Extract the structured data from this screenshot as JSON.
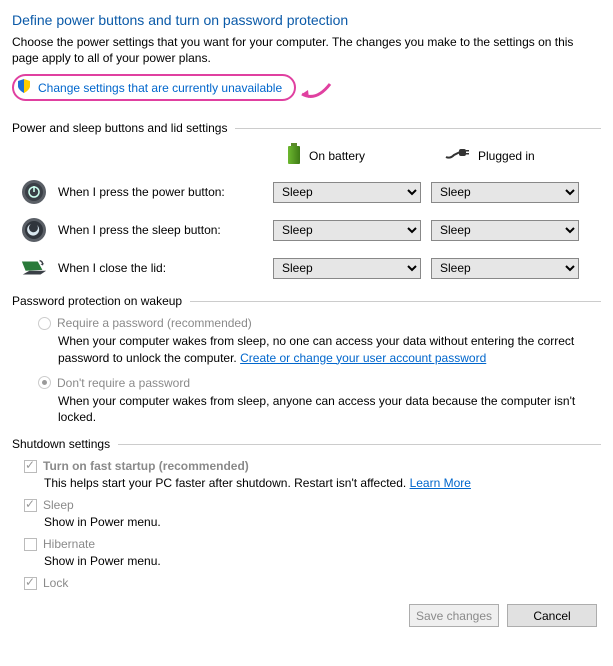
{
  "title": "Define power buttons and turn on password protection",
  "desc": "Choose the power settings that you want for your computer. The changes you make to the settings on this page apply to all of your power plans.",
  "change_link": "Change settings that are currently unavailable",
  "section_buttons": "Power and sleep buttons and lid settings",
  "col_battery": "On battery",
  "col_plugged": "Plugged in",
  "rows": {
    "power": {
      "label": "When I press the power button:",
      "battery": "Sleep",
      "plugged": "Sleep"
    },
    "sleep": {
      "label": "When I press the sleep button:",
      "battery": "Sleep",
      "plugged": "Sleep"
    },
    "lid": {
      "label": "When I close the lid:",
      "battery": "Sleep",
      "plugged": "Sleep"
    }
  },
  "section_password": "Password protection on wakeup",
  "pw_require": {
    "label": "Require a password (recommended)",
    "text_a": "When your computer wakes from sleep, no one can access your data without entering the correct password to unlock the computer. ",
    "link": "Create or change your user account password"
  },
  "pw_none": {
    "label": "Don't require a password",
    "text": "When your computer wakes from sleep, anyone can access your data because the computer isn't locked."
  },
  "section_shutdown": "Shutdown settings",
  "fast_startup": {
    "label": "Turn on fast startup (recommended)",
    "text_a": "This helps start your PC faster after shutdown. Restart isn't affected. ",
    "link": "Learn More"
  },
  "sleep_chk": {
    "label": "Sleep",
    "text": "Show in Power menu."
  },
  "hibernate_chk": {
    "label": "Hibernate",
    "text": "Show in Power menu."
  },
  "lock_chk": {
    "label": "Lock"
  },
  "buttons": {
    "save": "Save changes",
    "cancel": "Cancel"
  }
}
